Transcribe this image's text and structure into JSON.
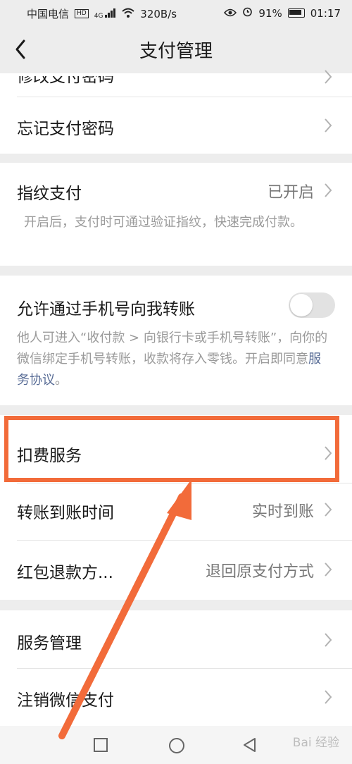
{
  "status_bar": {
    "carrier": "中国电信",
    "hd_badge": "HD",
    "signal_type": "4G",
    "net_speed": "320B/s",
    "battery": "91%",
    "time": "01:17"
  },
  "nav": {
    "title": "支付管理"
  },
  "rows": {
    "partial_top": "修改支付密码",
    "forgot_password": "忘记支付密码",
    "fingerprint": {
      "title": "指纹支付",
      "value": "已开启",
      "desc": "开启后，支付时可通过验证指纹，快速完成付款。"
    },
    "phone_transfer": {
      "title": "允许通过手机号向我转账",
      "desc": "他人可进入“收付款 > 向银行卡或手机号转账”，向你的微信绑定手机号转账，收款将存入零钱。开启即同意",
      "link": "服务协议",
      "desc_end": "。",
      "toggle_on": false
    },
    "deduction": "扣费服务",
    "transfer_time": {
      "title": "转账到账时间",
      "value": "实时到账"
    },
    "red_packet": {
      "title": "红包退款方...",
      "value": "退回原支付方式"
    },
    "service_manage": "服务管理",
    "cancel_pay": "注销微信支付"
  },
  "watermark": "Bai 经验",
  "colors": {
    "highlight": "#f26b3a",
    "link": "#576b95",
    "background": "#ededed"
  }
}
